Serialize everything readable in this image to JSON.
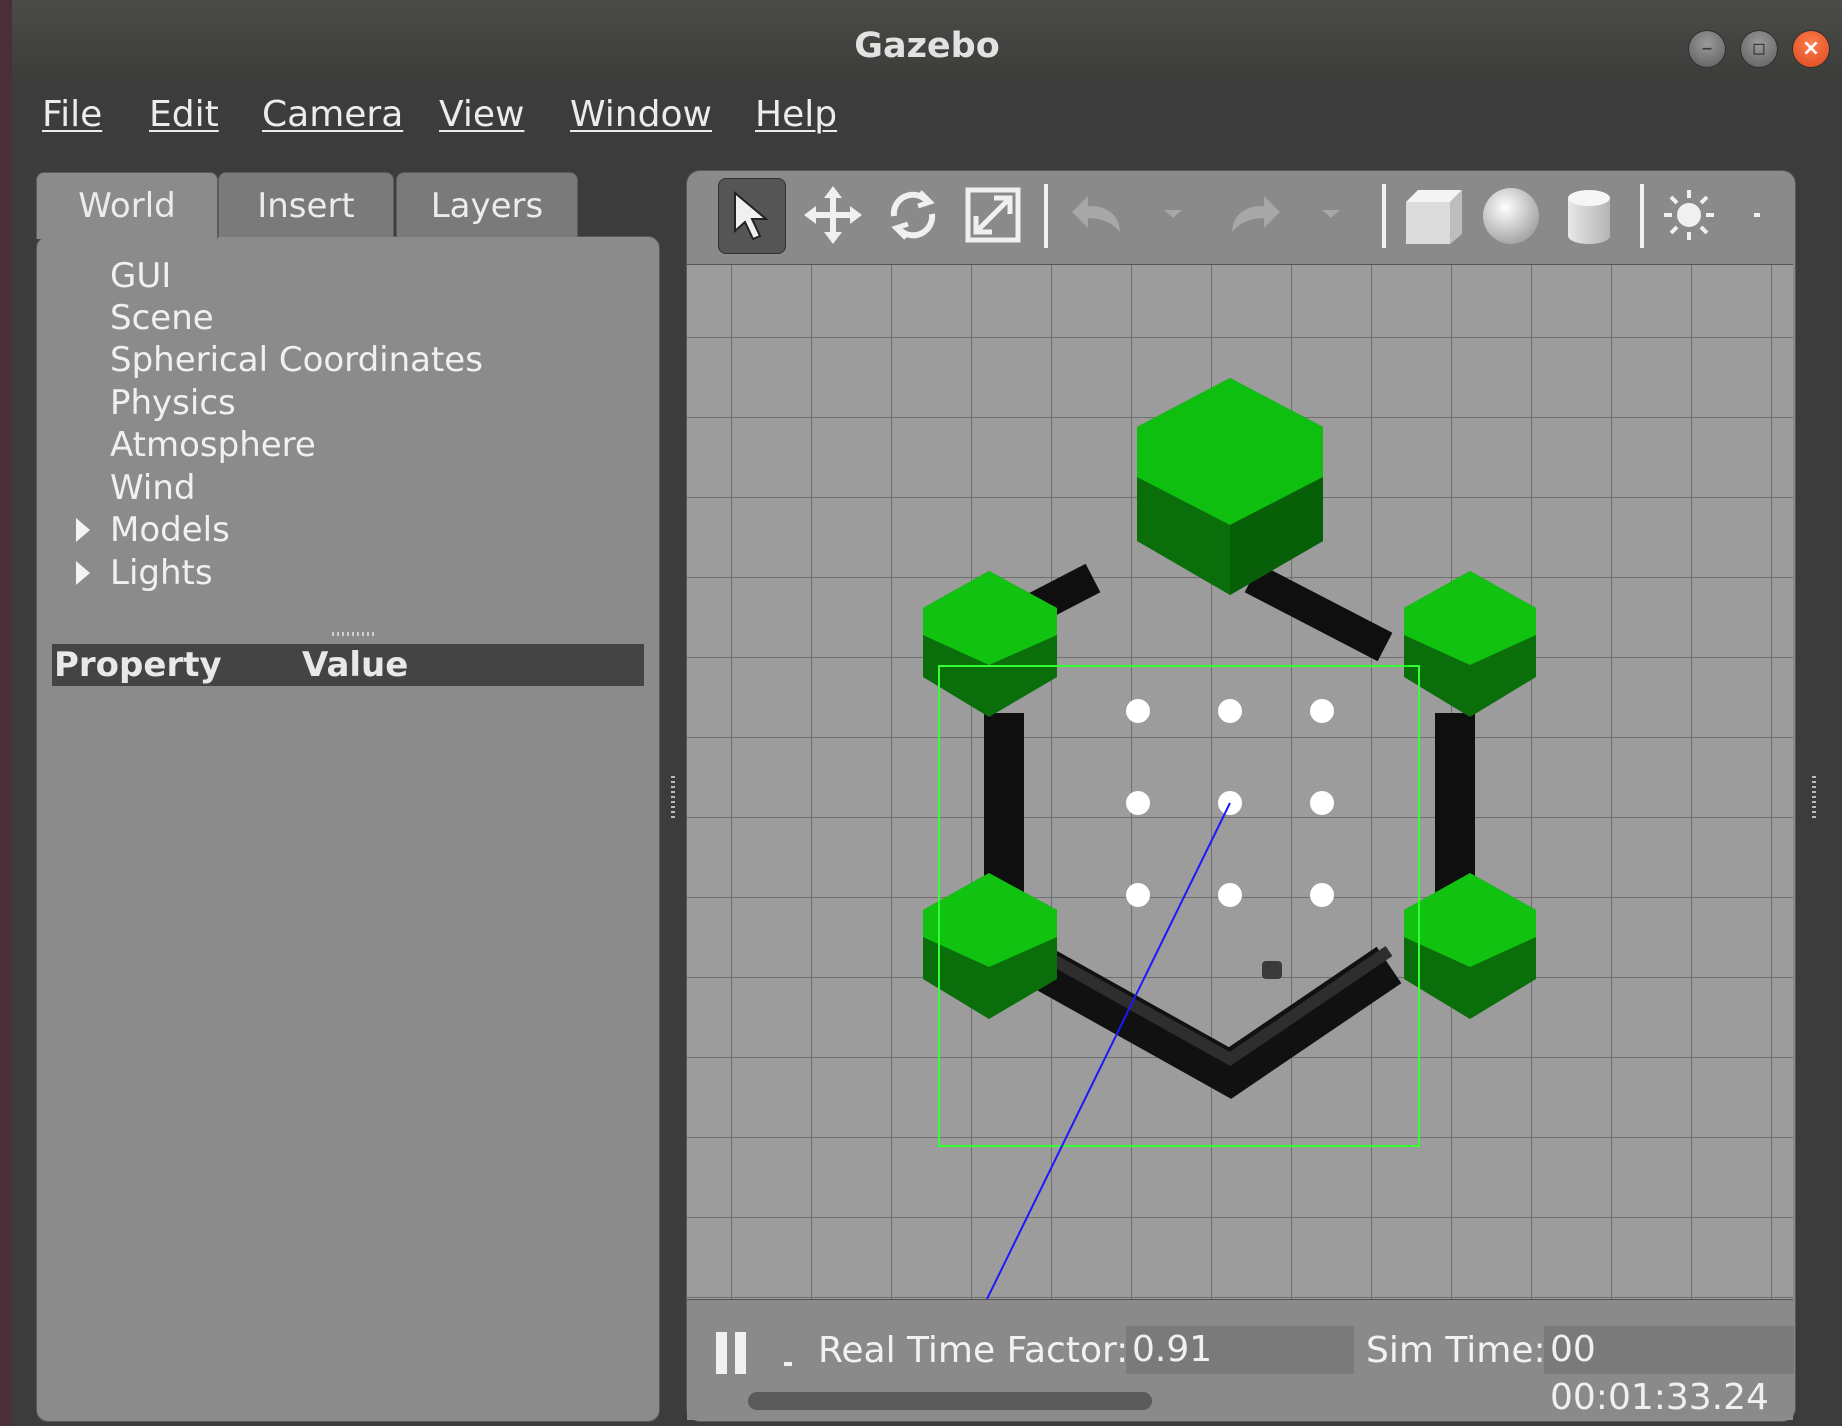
{
  "window": {
    "title": "Gazebo",
    "controls": [
      "minimize",
      "maximize",
      "close"
    ]
  },
  "menu": [
    {
      "label": "File"
    },
    {
      "label": "Edit"
    },
    {
      "label": "Camera"
    },
    {
      "label": "View"
    },
    {
      "label": "Window"
    },
    {
      "label": "Help"
    }
  ],
  "tabs": [
    {
      "label": "World"
    },
    {
      "label": "Insert"
    },
    {
      "label": "Layers"
    }
  ],
  "active_tab": "World",
  "tree": [
    {
      "label": "GUI"
    },
    {
      "label": "Scene"
    },
    {
      "label": "Spherical Coordinates"
    },
    {
      "label": "Physics"
    },
    {
      "label": "Atmosphere"
    },
    {
      "label": "Wind"
    },
    {
      "label": "Models",
      "expandable": true
    },
    {
      "label": "Lights",
      "expandable": true
    }
  ],
  "property_table": {
    "columns": [
      "Property",
      "Value"
    ]
  },
  "toolbar": {
    "tools": [
      "select-arrow-icon",
      "translate-icon",
      "rotate-icon",
      "scale-icon",
      "undo-icon",
      "redo-icon",
      "box-shape-icon",
      "sphere-shape-icon",
      "cylinder-shape-icon",
      "point-light-icon"
    ]
  },
  "status": {
    "real_time_factor_label": "Real Time Factor:",
    "real_time_factor": "0.91",
    "sim_time_label": "Sim Time:",
    "sim_time": "00 00:01:33.24"
  },
  "colors": {
    "green_model": "#22b022",
    "grid": "#6e6e6e",
    "selection_box": "#3cff3c",
    "ray": "#1a1aff"
  }
}
